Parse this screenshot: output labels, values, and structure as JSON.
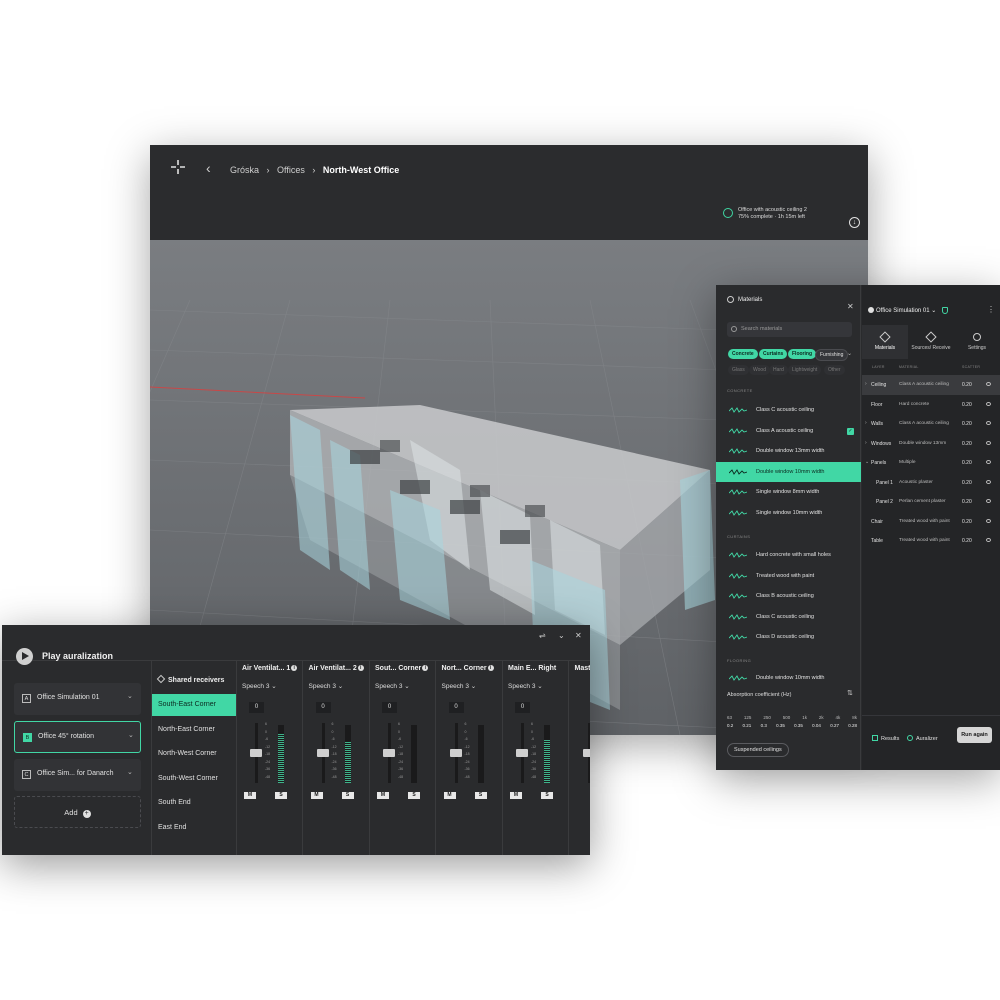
{
  "viewer": {
    "breadcrumb": [
      "Gróska",
      "Offices",
      "North-West Office"
    ],
    "back_icon": "chevron-left-icon",
    "status_line1": "Office with acoustic ceiling 2",
    "status_line2": "75% complete · 1h 15m left",
    "status_progress": 0.75
  },
  "materials": {
    "title": "Materials",
    "search_placeholder": "Search materials",
    "filters_active": [
      "Concrete",
      "Curtains",
      "Flooring"
    ],
    "filters_other": [
      "Furnishing"
    ],
    "filters_faded": [
      "Glass",
      "Wood",
      "Hard",
      "Lightweight",
      "Other"
    ],
    "sections": {
      "concrete": "CONCRETE",
      "curtains": "CURTAINS",
      "flooring": "FLOORING"
    },
    "concrete_items": [
      "Class C acoustic ceiling",
      "Class A acoustic ceiling",
      "Double window 13mm width",
      "Double window 10mm width",
      "Single window 8mm width",
      "Single window 10mm width"
    ],
    "curtain_items": [
      "Hard concrete with small holes",
      "Treated wood with paint",
      "Class B acoustic ceiling",
      "Class C acoustic ceiling",
      "Class D acoustic ceiling"
    ],
    "flooring_items": [
      "Double window 10mm width"
    ],
    "selected_item": "Double window 10mm width",
    "checked_item": "Class A acoustic ceiling",
    "absorption_title": "Absorption coefficient (Hz)",
    "freqs": [
      "63",
      "125",
      "250",
      "500",
      "1k",
      "2k",
      "4k",
      "8k"
    ],
    "coeffs": [
      "0.2",
      "0.21",
      "0.3",
      "0.35",
      "0.35",
      "0.04",
      "0.27",
      "0.28"
    ],
    "suspended_label": "Suspended ceilings"
  },
  "sim_panel": {
    "title": "Office Simulation 01",
    "tabs": [
      "Materials",
      "Sources/ Receive",
      "Settings"
    ],
    "col_layer": "LAYER",
    "col_material": "MATERIAL",
    "col_scatter": "SCATTER",
    "layers": [
      {
        "name": "Ceiling",
        "material": "Class A acoustic ceiling",
        "scatter": "0.20",
        "caret": "›"
      },
      {
        "name": "Floor",
        "material": "Hard concrete",
        "scatter": "0.20",
        "caret": ""
      },
      {
        "name": "Walls",
        "material": "Class A acoustic ceiling",
        "scatter": "0.20",
        "caret": "›"
      },
      {
        "name": "Windows",
        "material": "Double window 13mm",
        "scatter": "0.20",
        "caret": "›"
      },
      {
        "name": "Panels",
        "material": "Multiple",
        "scatter": "0.20",
        "caret": "⌄"
      },
      {
        "name": "Panel 1",
        "material": "Acoustic plaster",
        "scatter": "0.20",
        "caret": ""
      },
      {
        "name": "Panel 2",
        "material": "Perlan cement plaster",
        "scatter": "0.20",
        "caret": ""
      },
      {
        "name": "Chair",
        "material": "Treated wood with paint",
        "scatter": "0.20",
        "caret": ""
      },
      {
        "name": "Table",
        "material": "Treated wood with paint",
        "scatter": "0.20",
        "caret": ""
      }
    ],
    "results_label": "Results",
    "auralizer_label": "Auralizer",
    "run_again_label": "Run again"
  },
  "auralization": {
    "title": "Play auralization",
    "simulations": [
      {
        "key": "A",
        "name": "Office Simulation 01"
      },
      {
        "key": "B",
        "name": "Office 45° rotation"
      },
      {
        "key": "C",
        "name": "Office Sim... for Danarch"
      }
    ],
    "add_label": "Add",
    "receivers_title": "Shared receivers",
    "receivers": [
      "South-East Corner",
      "North-East Corner",
      "North-West Corner",
      "South-West Corner",
      "South End",
      "East End"
    ],
    "strips": [
      {
        "name": "Air Ventilat... 1",
        "source": "Speech 3",
        "value": "0",
        "level": 0.5,
        "meter": 0.85
      },
      {
        "name": "Air Ventilat... 2",
        "source": "Speech 3",
        "value": "0",
        "level": 0.5,
        "meter": 0.7
      },
      {
        "name": "Sout... Corner",
        "source": "Speech 3",
        "value": "0",
        "level": 0.5,
        "meter": 0.0
      },
      {
        "name": "Nort... Corner",
        "source": "Speech 3",
        "value": "0",
        "level": 0.5,
        "meter": 0.0
      },
      {
        "name": "Main E... Right",
        "source": "Speech 3",
        "value": "0",
        "level": 0.5,
        "meter": 0.75
      },
      {
        "name": "Master",
        "source": "",
        "value": "",
        "level": 0.5,
        "meter": 0.0
      }
    ],
    "scale": [
      "6",
      "0",
      "-6",
      "-12",
      "-18",
      "-24",
      "-36",
      "-48"
    ],
    "mute_label": "M",
    "solo_label": "S"
  },
  "colors": {
    "accent": "#41d7a5",
    "panel_bg": "#2a2b2d",
    "viewport_bg": "#6e7175"
  }
}
